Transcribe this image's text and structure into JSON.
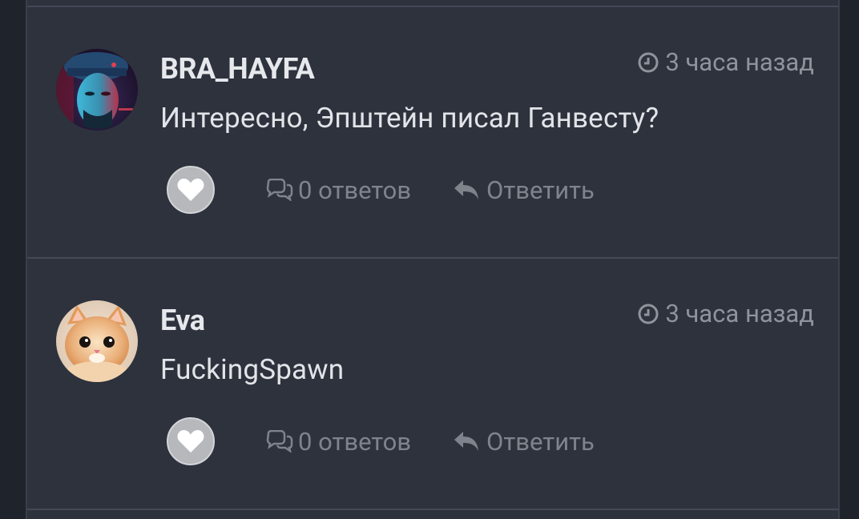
{
  "comments": [
    {
      "username": "BRA_HAYFA",
      "time": "3 часа назад",
      "text": "Интересно, Эпштейн писал Ганвесту?",
      "replies": "0 ответов",
      "reply_label": "Ответить",
      "avatar": "man-neon-portrait"
    },
    {
      "username": "Eva",
      "time": "3 часа назад",
      "text": "FuckingSpawn",
      "replies": "0 ответов",
      "reply_label": "Ответить",
      "avatar": "kitten-photo"
    }
  ],
  "icons": {
    "clock": "clock-icon",
    "like": "heart-icon",
    "replies": "chat-bubbles-icon",
    "reply": "reply-arrow-icon"
  },
  "colors": {
    "background": "#1f232b",
    "panel": "#2d323d",
    "divider": "#434955",
    "username": "#e6e8ec",
    "muted": "#7f848c",
    "like_button": "#b6b8bc"
  }
}
